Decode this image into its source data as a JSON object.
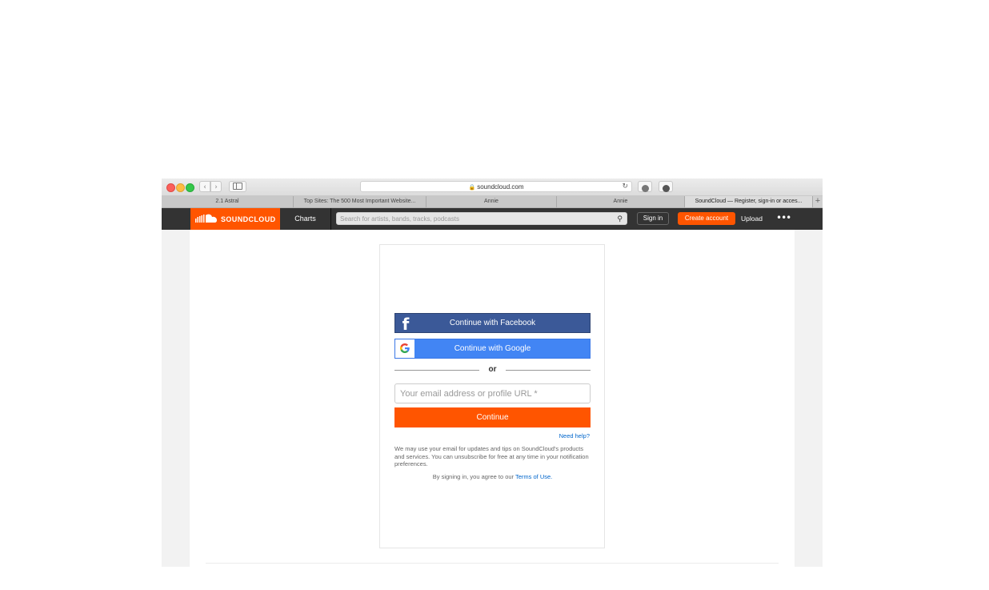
{
  "browser": {
    "address": "soundcloud.com",
    "tabs": [
      {
        "label": "2.1 Astral",
        "active": false
      },
      {
        "label": "Top Sites: The 500 Most Important Website...",
        "active": false
      },
      {
        "label": "Annie",
        "active": false
      },
      {
        "label": "Annie",
        "active": false
      },
      {
        "label": "SoundCloud — Register, sign-in or acces...",
        "active": true
      }
    ],
    "new_tab": "+"
  },
  "header": {
    "logo": "SOUNDCLOUD",
    "charts": "Charts",
    "search_placeholder": "Search for artists, bands, tracks, podcasts",
    "sign_in": "Sign in",
    "create_account": "Create account",
    "upload": "Upload",
    "more": "•••"
  },
  "login": {
    "facebook": "Continue with Facebook",
    "facebook_icon": "f",
    "google": "Continue with Google",
    "or": "or",
    "email_placeholder": "Your email address or profile URL *",
    "continue": "Continue",
    "need_help": "Need help?",
    "disclaimer": "We may use your email for updates and tips on SoundCloud's products and services. You can unsubscribe for free at any time in your notification preferences.",
    "terms_prefix": "By signing in, you agree to our",
    "terms_link": "Terms of Use."
  },
  "colors": {
    "brand": "#ff5500",
    "header_bg": "#333333",
    "facebook": "#3b5998",
    "google": "#4285f4",
    "link": "#0066cc"
  }
}
